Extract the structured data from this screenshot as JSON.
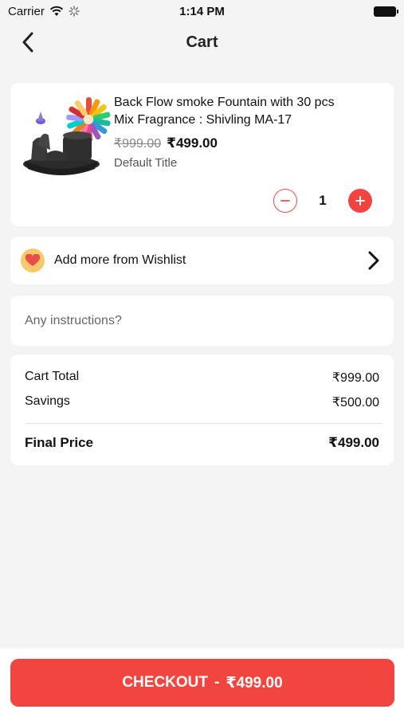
{
  "status_bar": {
    "carrier": "Carrier",
    "time": "1:14 PM"
  },
  "nav": {
    "title": "Cart"
  },
  "product": {
    "name": "Back Flow smoke Fountain with 30 pcs Mix Fragrance : Shivling MA-17",
    "original_price": "₹999.00",
    "price": "₹499.00",
    "variant": "Default Title",
    "quantity": "1"
  },
  "wishlist": {
    "label": "Add more from Wishlist"
  },
  "instructions": {
    "placeholder": "Any instructions?",
    "value": ""
  },
  "totals": {
    "cart_total_label": "Cart Total",
    "cart_total_value": "₹999.00",
    "savings_label": "Savings",
    "savings_value": "₹500.00",
    "final_label": "Final Price",
    "final_value": "₹499.00"
  },
  "checkout": {
    "label": "CHECKOUT",
    "separator": "-",
    "amount": "₹499.00"
  },
  "colors": {
    "accent": "#f3453f",
    "background": "#f4f4f4",
    "heart_badge": "#f8c86a"
  },
  "icons": [
    "wifi-icon",
    "loading-icon",
    "battery-icon",
    "back-chevron-icon",
    "product-image",
    "minus-icon",
    "plus-icon",
    "heart-icon",
    "chevron-right-icon"
  ]
}
